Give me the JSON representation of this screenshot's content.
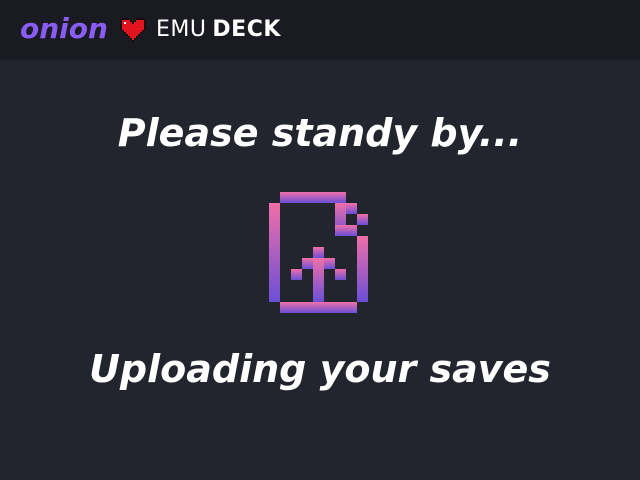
{
  "header": {
    "brand_onion": "onion",
    "brand_emu": "EMU",
    "brand_deck": "DECK",
    "heart_icon": "pixel-heart-icon"
  },
  "main": {
    "headline": "Please standy by...",
    "icon": "file-upload-icon",
    "status": "Uploading your saves"
  },
  "colors": {
    "background": "#23252e",
    "topbar": "#1a1b22",
    "onion_purple": "#8a5cf6",
    "heart_red": "#e0141e",
    "icon_gradient_top": "#f06fa8",
    "icon_gradient_bottom": "#6a4fd6",
    "text": "#ffffff"
  }
}
